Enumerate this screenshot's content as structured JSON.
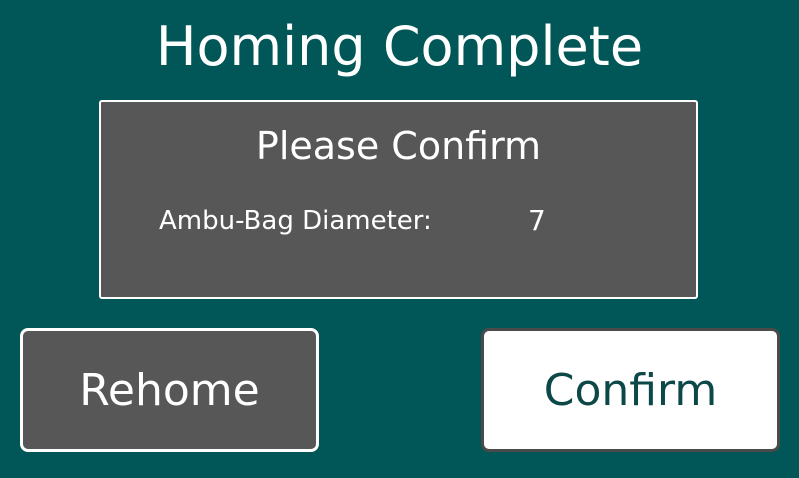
{
  "screen": {
    "title": "Homing Complete"
  },
  "confirm_panel": {
    "title": "Please Confirm",
    "parameter_label": "Ambu-Bag Diameter:",
    "parameter_value": "7"
  },
  "buttons": {
    "rehome_label": "Rehome",
    "confirm_label": "Confirm"
  },
  "colors": {
    "background": "#015757",
    "panel": "#575757",
    "confirm_text": "#0d4848",
    "border": "#ffffff"
  }
}
